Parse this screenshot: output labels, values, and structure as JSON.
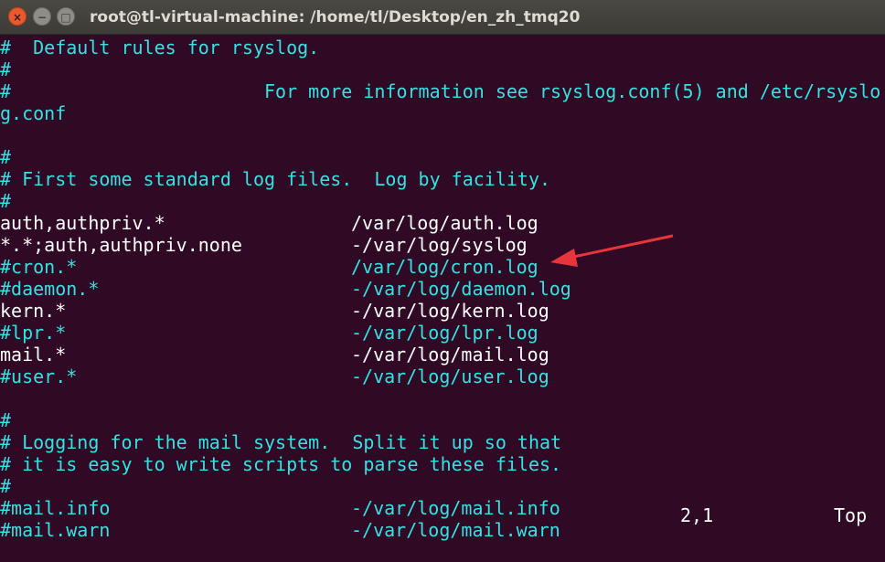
{
  "window": {
    "title": "root@tl-virtual-machine: /home/tl/Desktop/en_zh_tmq20",
    "close_glyph": "×",
    "minimize_glyph": "−",
    "maximize_glyph": "□"
  },
  "editor": {
    "lines": [
      {
        "text": "#  Default rules for rsyslog.",
        "color": "#34e2e2"
      },
      {
        "text": "#",
        "color": "#34e2e2"
      },
      {
        "text": "#                       For more information see rsyslog.conf(5) and /etc/rsyslo",
        "color": "#34e2e2"
      },
      {
        "text": "g.conf",
        "color": "#34e2e2"
      },
      {
        "text": "",
        "color": "#34e2e2"
      },
      {
        "text": "#",
        "color": "#34e2e2"
      },
      {
        "text": "# First some standard log files.  Log by facility.",
        "color": "#34e2e2"
      },
      {
        "text": "#",
        "color": "#34e2e2"
      },
      {
        "selector": "auth,authpriv.*",
        "action": "/var/log/auth.log",
        "color": "#ffffff"
      },
      {
        "selector": "*.*;auth,authpriv.none",
        "action": "-/var/log/syslog",
        "color": "#ffffff"
      },
      {
        "selector": "#cron.*",
        "action": "/var/log/cron.log",
        "color": "#34e2e2"
      },
      {
        "selector": "#daemon.*",
        "action": "-/var/log/daemon.log",
        "color": "#34e2e2"
      },
      {
        "selector": "kern.*",
        "action": "-/var/log/kern.log",
        "color": "#ffffff"
      },
      {
        "selector": "#lpr.*",
        "action": "-/var/log/lpr.log",
        "color": "#34e2e2"
      },
      {
        "selector": "mail.*",
        "action": "-/var/log/mail.log",
        "color": "#ffffff"
      },
      {
        "selector": "#user.*",
        "action": "-/var/log/user.log",
        "color": "#34e2e2"
      },
      {
        "text": "",
        "color": "#34e2e2"
      },
      {
        "text": "#",
        "color": "#34e2e2"
      },
      {
        "text": "# Logging for the mail system.  Split it up so that",
        "color": "#34e2e2"
      },
      {
        "text": "# it is easy to write scripts to parse these files.",
        "color": "#34e2e2"
      },
      {
        "text": "#",
        "color": "#34e2e2"
      },
      {
        "selector": "#mail.info",
        "action": "-/var/log/mail.info",
        "color": "#34e2e2"
      },
      {
        "selector": "#mail.warn",
        "action": "-/var/log/mail.warn",
        "color": "#34e2e2"
      }
    ]
  },
  "status_bar": {
    "cursor_position": "2,1",
    "scroll_position": "Top"
  },
  "annotation": {
    "arrow_color": "#e8343a"
  },
  "colors": {
    "background": "#300a24",
    "comment": "#34e2e2",
    "text": "#ffffff",
    "titlebar": "#3c3b37"
  }
}
